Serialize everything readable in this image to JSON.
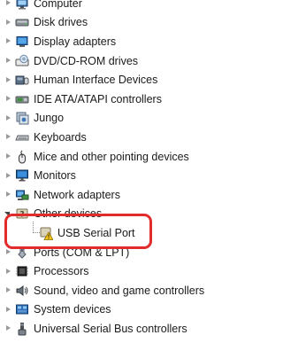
{
  "device_tree": {
    "items": [
      {
        "label": "Computer",
        "icon": "computer-icon",
        "state": "collapsed"
      },
      {
        "label": "Disk drives",
        "icon": "disk-drive-icon",
        "state": "collapsed"
      },
      {
        "label": "Display adapters",
        "icon": "display-adapter-icon",
        "state": "collapsed"
      },
      {
        "label": "DVD/CD-ROM drives",
        "icon": "dvd-drive-icon",
        "state": "collapsed"
      },
      {
        "label": "Human Interface Devices",
        "icon": "hid-icon",
        "state": "collapsed"
      },
      {
        "label": "IDE ATA/ATAPI controllers",
        "icon": "ide-controller-icon",
        "state": "collapsed"
      },
      {
        "label": "Jungo",
        "icon": "jungo-icon",
        "state": "collapsed"
      },
      {
        "label": "Keyboards",
        "icon": "keyboard-icon",
        "state": "collapsed"
      },
      {
        "label": "Mice and other pointing devices",
        "icon": "mouse-icon",
        "state": "collapsed"
      },
      {
        "label": "Monitors",
        "icon": "monitor-icon",
        "state": "collapsed"
      },
      {
        "label": "Network adapters",
        "icon": "network-adapter-icon",
        "state": "collapsed"
      },
      {
        "label": "Other devices",
        "icon": "other-devices-icon",
        "state": "expanded"
      },
      {
        "label": "USB Serial Port",
        "icon": "usb-serial-warning-icon",
        "state": "child"
      },
      {
        "label": "Ports (COM & LPT)",
        "icon": "ports-icon",
        "state": "collapsed"
      },
      {
        "label": "Processors",
        "icon": "processor-icon",
        "state": "collapsed"
      },
      {
        "label": "Sound, video and game controllers",
        "icon": "sound-icon",
        "state": "collapsed"
      },
      {
        "label": "System devices",
        "icon": "system-devices-icon",
        "state": "collapsed"
      },
      {
        "label": "Universal Serial Bus controllers",
        "icon": "usb-controller-icon",
        "state": "collapsed"
      }
    ]
  },
  "highlight": {
    "color": "#e22b2b"
  }
}
